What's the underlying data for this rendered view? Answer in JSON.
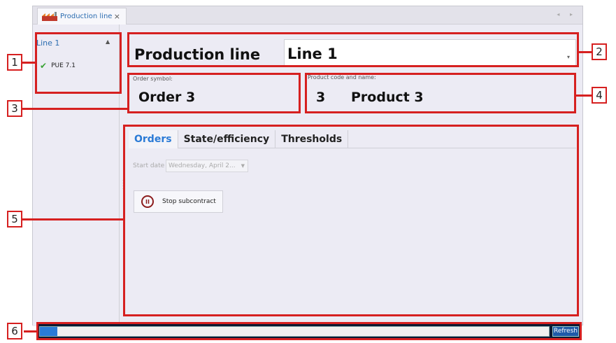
{
  "tab": {
    "title": "Production line",
    "close": "×",
    "nav": "◂ ▸"
  },
  "tree": {
    "title": "Line 1",
    "caret": "▲",
    "items": [
      {
        "icon": "check-icon",
        "label": "PUE 7.1"
      }
    ]
  },
  "header": {
    "label": "Production line",
    "value": "Line 1"
  },
  "order": {
    "label": "Order symbol:",
    "value": "Order 3"
  },
  "product": {
    "label": "Product code and name:",
    "code": "3",
    "name": "Product 3"
  },
  "panel_tabs": [
    "Orders",
    "State/efficiency",
    "Thresholds"
  ],
  "start_date": {
    "label": "Start date",
    "value": "Wednesday, April 2..."
  },
  "stop_button": {
    "label": "Stop subcontract",
    "icon": "pause-icon"
  },
  "progress": {
    "value": 0.035
  },
  "refresh": "Refresh",
  "callouts": [
    "1",
    "2",
    "3",
    "4",
    "5",
    "6"
  ],
  "colors": {
    "callout": "#d62020",
    "accent": "#2b7bd6",
    "status_bar": "#0b1a33"
  }
}
